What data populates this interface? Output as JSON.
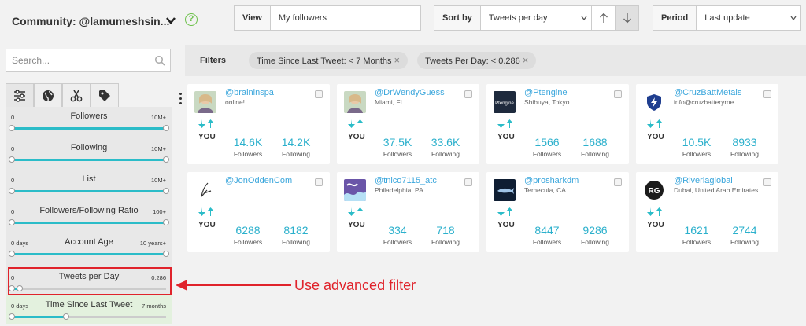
{
  "header": {
    "community": "Community: @lamumeshsin...",
    "help": "?",
    "view": {
      "label": "View",
      "value": "My followers"
    },
    "sort": {
      "label": "Sort by",
      "value": "Tweets per day"
    },
    "period": {
      "label": "Period",
      "value": "Last update"
    }
  },
  "sidebar": {
    "search_placeholder": "Search...",
    "filters": [
      {
        "name": "Followers",
        "min": "0",
        "max": "10M+",
        "from": 0,
        "to": 1
      },
      {
        "name": "Following",
        "min": "0",
        "max": "10M+",
        "from": 0,
        "to": 1
      },
      {
        "name": "List",
        "min": "0",
        "max": "10M+",
        "from": 0,
        "to": 1
      },
      {
        "name": "Followers/Following Ratio",
        "min": "0",
        "max": "100+",
        "from": 0,
        "to": 1
      },
      {
        "name": "Account Age",
        "min": "0 days",
        "max": "10 years+",
        "from": 0,
        "to": 1
      },
      {
        "name": "Tweets per Day",
        "min": "0",
        "max": "0.286",
        "from": 0,
        "to": 0.05
      },
      {
        "name": "Time Since Last Tweet",
        "min": "0 days",
        "max": "7 months",
        "from": 0,
        "to": 0.35
      }
    ]
  },
  "filters_bar": {
    "title": "Filters",
    "chips": [
      "Time Since Last Tweet: < 7 Months",
      "Tweets Per Day: < 0.286"
    ]
  },
  "labels": {
    "you": "YOU",
    "followers": "Followers",
    "following": "Following"
  },
  "cards": [
    {
      "handle": "@braininspa",
      "sub": "online!",
      "followers": "14.6K",
      "following": "14.2K",
      "avatar": "photo-woman-icon"
    },
    {
      "handle": "@DrWendyGuess",
      "sub": "Miami, FL",
      "followers": "37.5K",
      "following": "33.6K",
      "avatar": "photo-woman-icon"
    },
    {
      "handle": "@Ptengine",
      "sub": "Shibuya, Tokyo",
      "followers": "1566",
      "following": "1688",
      "avatar": "ptengine-logo",
      "logo_text": "Ptengine"
    },
    {
      "handle": "@CruzBattMetals",
      "sub": "info@cruzbatteryme...",
      "followers": "10.5K",
      "following": "8933",
      "avatar": "cruz-shield-logo"
    },
    {
      "handle": "@JonOddenCom",
      "sub": "",
      "followers": "6288",
      "following": "8182",
      "avatar": "signature-logo"
    },
    {
      "handle": "@tnico7115_atc",
      "sub": "Philadelphia, PA",
      "followers": "334",
      "following": "718",
      "avatar": "purple-art-icon"
    },
    {
      "handle": "@prosharkdm",
      "sub": "Temecula, CA",
      "followers": "8447",
      "following": "9286",
      "avatar": "shark-logo"
    },
    {
      "handle": "@Riverlaglobal",
      "sub": "Dubai, United Arab Emirates",
      "followers": "1621",
      "following": "2744",
      "avatar": "rg-logo",
      "logo_text": "RG"
    }
  ],
  "annotation": "Use advanced filter",
  "colors": {
    "accent": "#2bbcc8",
    "link": "#3aa6dc",
    "annotation": "#e0232b",
    "help": "#6cc04a"
  }
}
